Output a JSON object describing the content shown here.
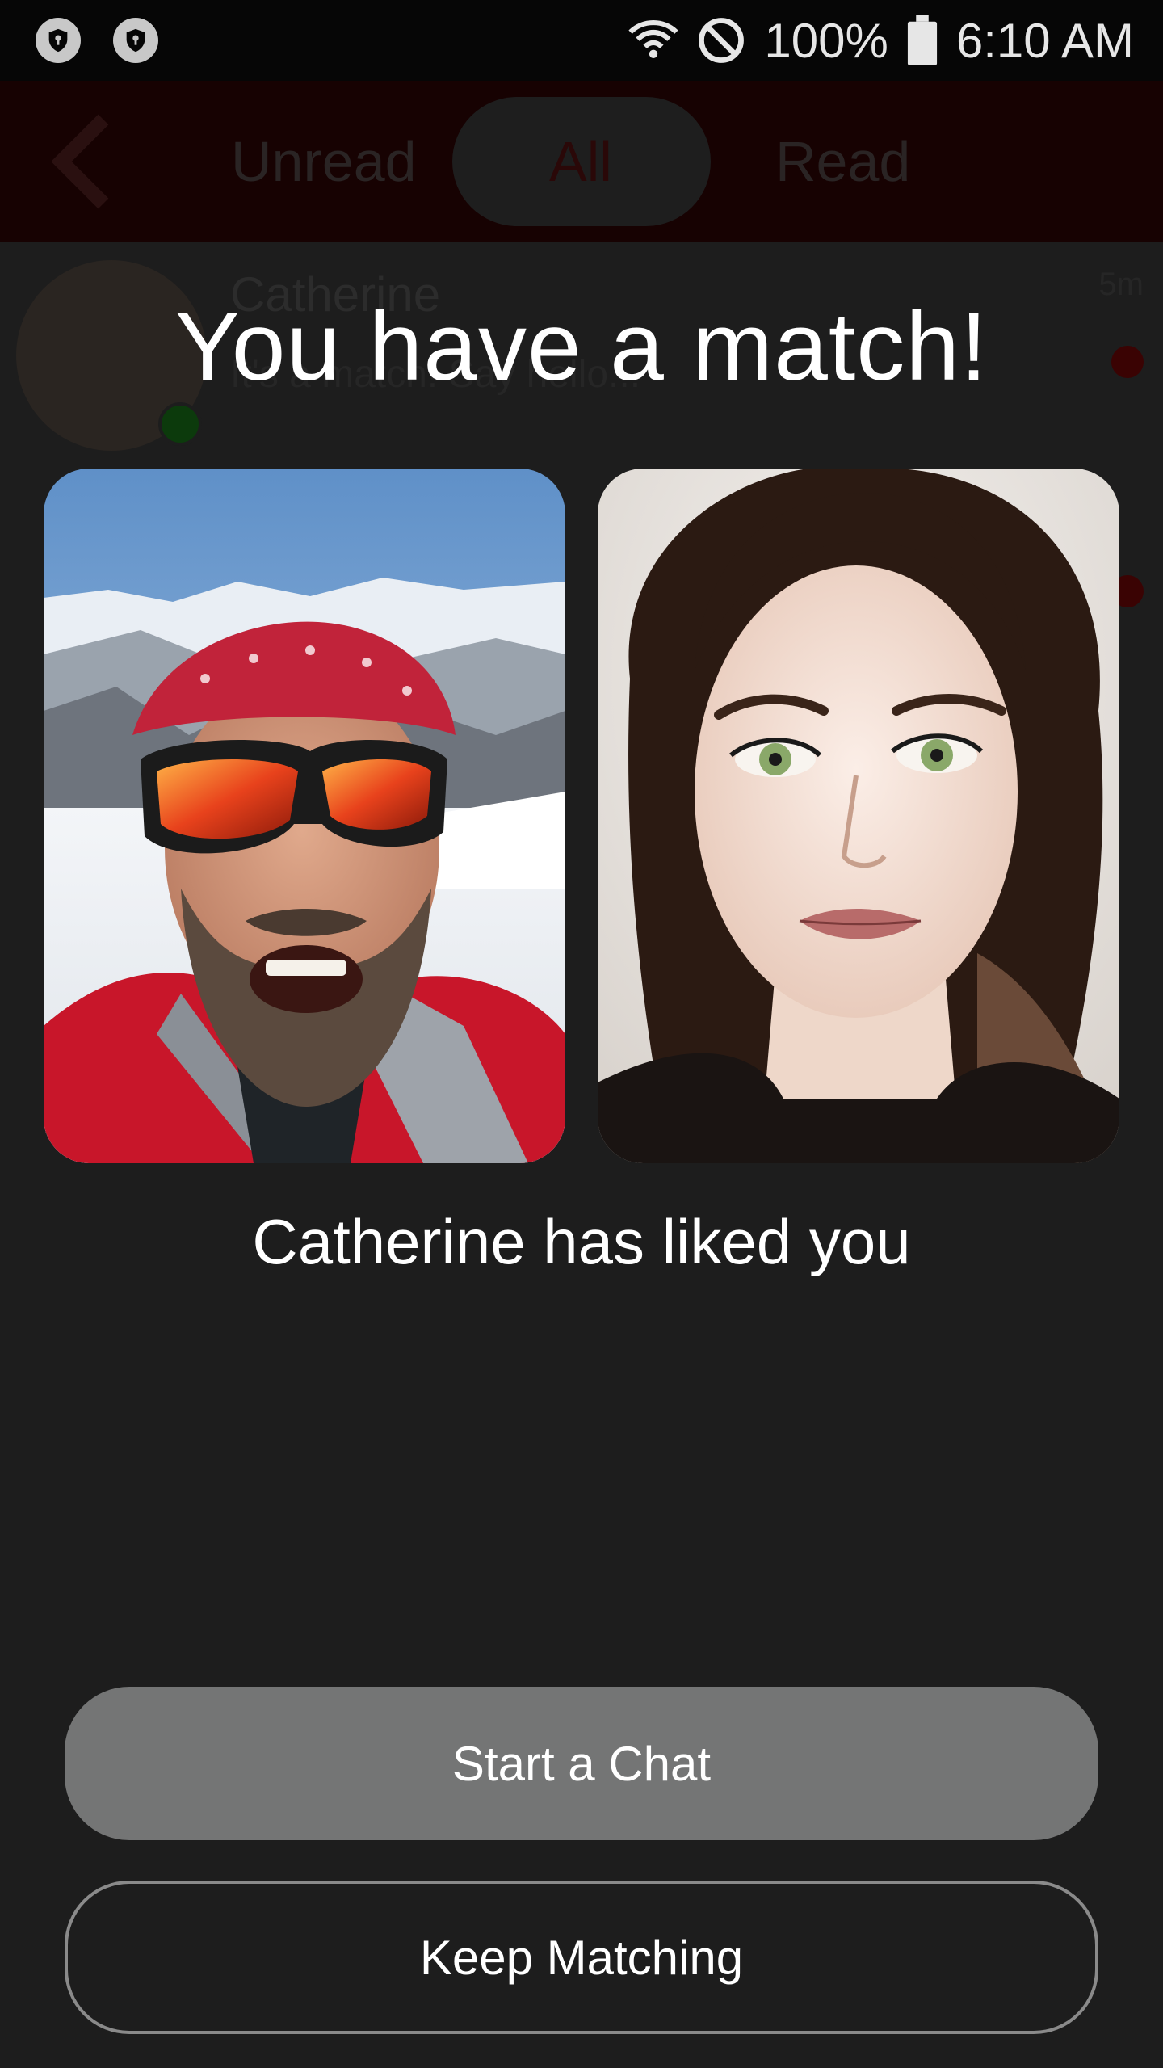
{
  "status_bar": {
    "battery": "100%",
    "time": "6:10 AM",
    "icons": [
      "shield-lock-icon",
      "shield-lock-icon",
      "wifi-icon",
      "do-not-disturb-icon",
      "battery-icon"
    ]
  },
  "background": {
    "tabs": {
      "unread": "Unread",
      "all": "All",
      "read": "Read"
    },
    "conversation": {
      "name": "Catherine",
      "message": "It's a match! Say hello...",
      "time": "5m"
    }
  },
  "match_dialog": {
    "title": "You have a match!",
    "subtitle": "Catherine has liked you",
    "start_chat_label": "Start a Chat",
    "keep_matching_label": "Keep Matching"
  },
  "colors": {
    "background": "#1d1d1d",
    "primary_button": "#747575",
    "accent_red": "#c00000"
  }
}
